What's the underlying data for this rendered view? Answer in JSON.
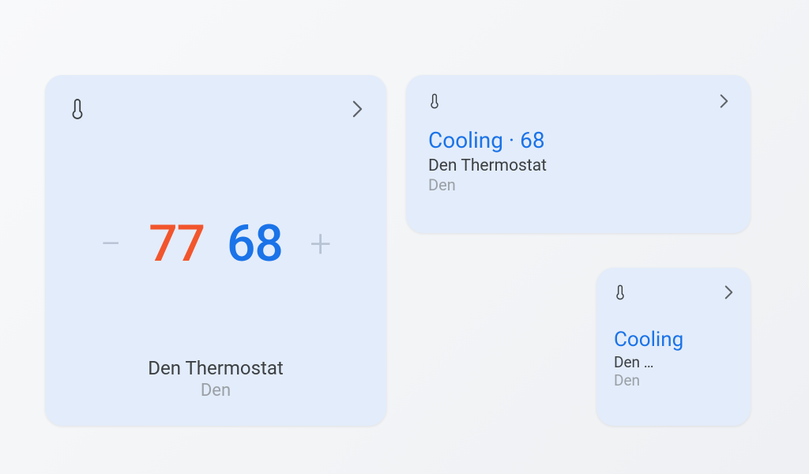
{
  "large": {
    "temp_heat": "77",
    "temp_cool": "68",
    "minus": "−",
    "plus": "+",
    "device_name": "Den Thermostat",
    "room": "Den"
  },
  "medium": {
    "status": "Cooling · 68",
    "device_name": "Den Thermostat",
    "room": "Den"
  },
  "small": {
    "status": "Cooling",
    "device_name": "Den …",
    "room": "Den"
  },
  "colors": {
    "card_bg": "#e3ecfa",
    "heat": "#f2552c",
    "cool": "#1a73e8",
    "muted": "#9aa0a6"
  }
}
